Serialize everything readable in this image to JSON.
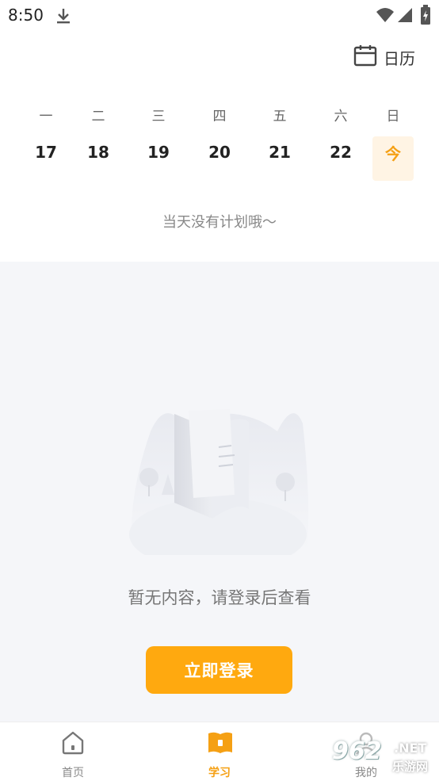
{
  "status_bar": {
    "time": "8:50"
  },
  "header": {
    "calendar_label": "日历"
  },
  "week": [
    {
      "weekday": "一",
      "date": "17",
      "today": false
    },
    {
      "weekday": "二",
      "date": "18",
      "today": false
    },
    {
      "weekday": "三",
      "date": "19",
      "today": false
    },
    {
      "weekday": "四",
      "date": "20",
      "today": false
    },
    {
      "weekday": "五",
      "date": "21",
      "today": false
    },
    {
      "weekday": "六",
      "date": "22",
      "today": false
    },
    {
      "weekday": "日",
      "date": "今",
      "today": true
    }
  ],
  "plan": {
    "empty_message": "当天没有计划哦～"
  },
  "content": {
    "empty_message": "暂无内容，请登录后查看",
    "login_button": "立即登录"
  },
  "tabs": [
    {
      "label": "首页",
      "icon": "home-icon",
      "active": false
    },
    {
      "label": "学习",
      "icon": "book-icon",
      "active": true
    },
    {
      "label": "我的",
      "icon": "profile-icon",
      "active": false
    }
  ],
  "watermark": {
    "brand": "962",
    "domain": ".NET",
    "sub": "乐游网"
  },
  "colors": {
    "accent": "#ffa90f",
    "today_bg": "#fff4e4",
    "content_bg": "#f5f6f9"
  }
}
